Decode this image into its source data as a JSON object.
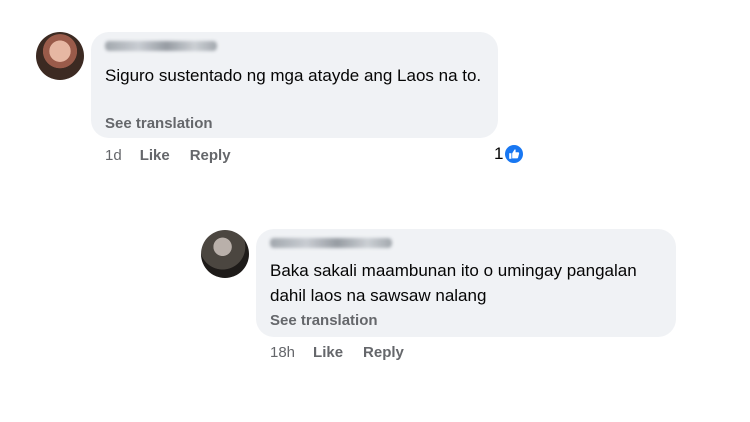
{
  "comments": [
    {
      "text": "Siguro sustentado ng mga atayde ang Laos na to.",
      "translation_label": "See translation",
      "time": "1d",
      "like_label": "Like",
      "reply_label": "Reply",
      "reaction_count": "1",
      "reaction_icon": "like-icon"
    },
    {
      "text": "Baka sakali maambunan ito o umingay pangalan dahil laos na sawsaw nalang",
      "translation_label": "See translation",
      "time": "18h",
      "like_label": "Like",
      "reply_label": "Reply"
    }
  ],
  "colors": {
    "bubble_bg": "#f0f2f5",
    "meta_text": "#65676b",
    "like_blue": "#1877f2"
  }
}
